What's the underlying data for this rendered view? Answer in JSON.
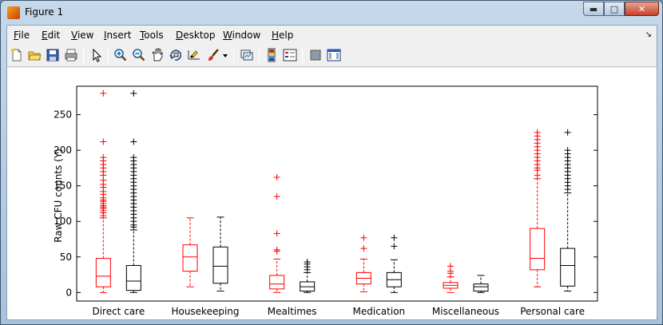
{
  "window": {
    "title": "Figure 1"
  },
  "menu": {
    "items": [
      "File",
      "Edit",
      "View",
      "Insert",
      "Tools",
      "Desktop",
      "Window",
      "Help"
    ]
  },
  "toolbar": {
    "icons": [
      "new-figure-icon",
      "open-file-icon",
      "save-icon",
      "print-icon",
      "pointer-icon",
      "zoom-in-icon",
      "zoom-out-icon",
      "pan-icon",
      "rotate-3d-icon",
      "data-cursor-icon",
      "brush-icon",
      "brush-dropdown-icon",
      "link-plot-icon",
      "insert-colorbar-icon",
      "insert-legend-icon",
      "hide-plot-tools-icon",
      "show-plot-tools-icon"
    ]
  },
  "chart_data": {
    "type": "boxplot",
    "title": "",
    "xlabel": "",
    "ylabel": "Raw CFU counts (Y)",
    "ylim": [
      -12,
      290
    ],
    "yticks": [
      0,
      50,
      100,
      150,
      200,
      250
    ],
    "categories": [
      "Direct care",
      "Housekeeping",
      "Mealtimes",
      "Medication",
      "Miscellaneous",
      "Personal care"
    ],
    "series_colors": [
      "#ff0000",
      "#000000"
    ],
    "series": [
      {
        "color": "#ff0000",
        "boxes": [
          {
            "category": "Direct care",
            "min": 0,
            "q1": 8,
            "median": 23,
            "q3": 48,
            "max": 105,
            "outliers": [
              108,
              112,
              115,
              118,
              120,
              122,
              125,
              128,
              130,
              133,
              138,
              142,
              148,
              152,
              158,
              165,
              170,
              175,
              180,
              185,
              190,
              212,
              280
            ]
          },
          {
            "category": "Housekeeping",
            "min": 8,
            "q1": 30,
            "median": 50,
            "q3": 67,
            "max": 105,
            "outliers": []
          },
          {
            "category": "Mealtimes",
            "min": 0,
            "q1": 5,
            "median": 12,
            "q3": 24,
            "max": 47,
            "outliers": [
              58,
              60,
              83,
              135,
              162
            ]
          },
          {
            "category": "Medication",
            "min": 1,
            "q1": 12,
            "median": 20,
            "q3": 28,
            "max": 47,
            "outliers": [
              62,
              77
            ]
          },
          {
            "category": "Miscellaneous",
            "min": 0,
            "q1": 6,
            "median": 10,
            "q3": 14,
            "max": 22,
            "outliers": [
              27,
              30,
              37
            ]
          },
          {
            "category": "Personal care",
            "min": 8,
            "q1": 32,
            "median": 48,
            "q3": 90,
            "max": 160,
            "outliers": [
              165,
              172,
              175,
              180,
              185,
              190,
              195,
              200,
              205,
              210,
              215,
              220,
              225
            ]
          }
        ]
      },
      {
        "color": "#000000",
        "boxes": [
          {
            "category": "Direct care",
            "min": 0,
            "q1": 3,
            "median": 16,
            "q3": 38,
            "max": 88,
            "outliers": [
              92,
              95,
              100,
              105,
              110,
              115,
              120,
              125,
              130,
              135,
              140,
              145,
              150,
              155,
              160,
              165,
              170,
              175,
              180,
              185,
              190,
              212,
              280
            ]
          },
          {
            "category": "Housekeeping",
            "min": 2,
            "q1": 13,
            "median": 37,
            "q3": 64,
            "max": 106,
            "outliers": []
          },
          {
            "category": "Mealtimes",
            "min": 0,
            "q1": 2,
            "median": 8,
            "q3": 15,
            "max": 28,
            "outliers": [
              32,
              36,
              40,
              43
            ]
          },
          {
            "category": "Medication",
            "min": 0,
            "q1": 8,
            "median": 18,
            "q3": 28,
            "max": 46,
            "outliers": [
              65,
              77
            ]
          },
          {
            "category": "Miscellaneous",
            "min": 0,
            "q1": 2,
            "median": 8,
            "q3": 12,
            "max": 24,
            "outliers": []
          },
          {
            "category": "Personal care",
            "min": 2,
            "q1": 9,
            "median": 38,
            "q3": 62,
            "max": 140,
            "outliers": [
              145,
              150,
              155,
              160,
              165,
              170,
              175,
              180,
              185,
              190,
              195,
              200,
              225
            ]
          }
        ]
      }
    ]
  }
}
